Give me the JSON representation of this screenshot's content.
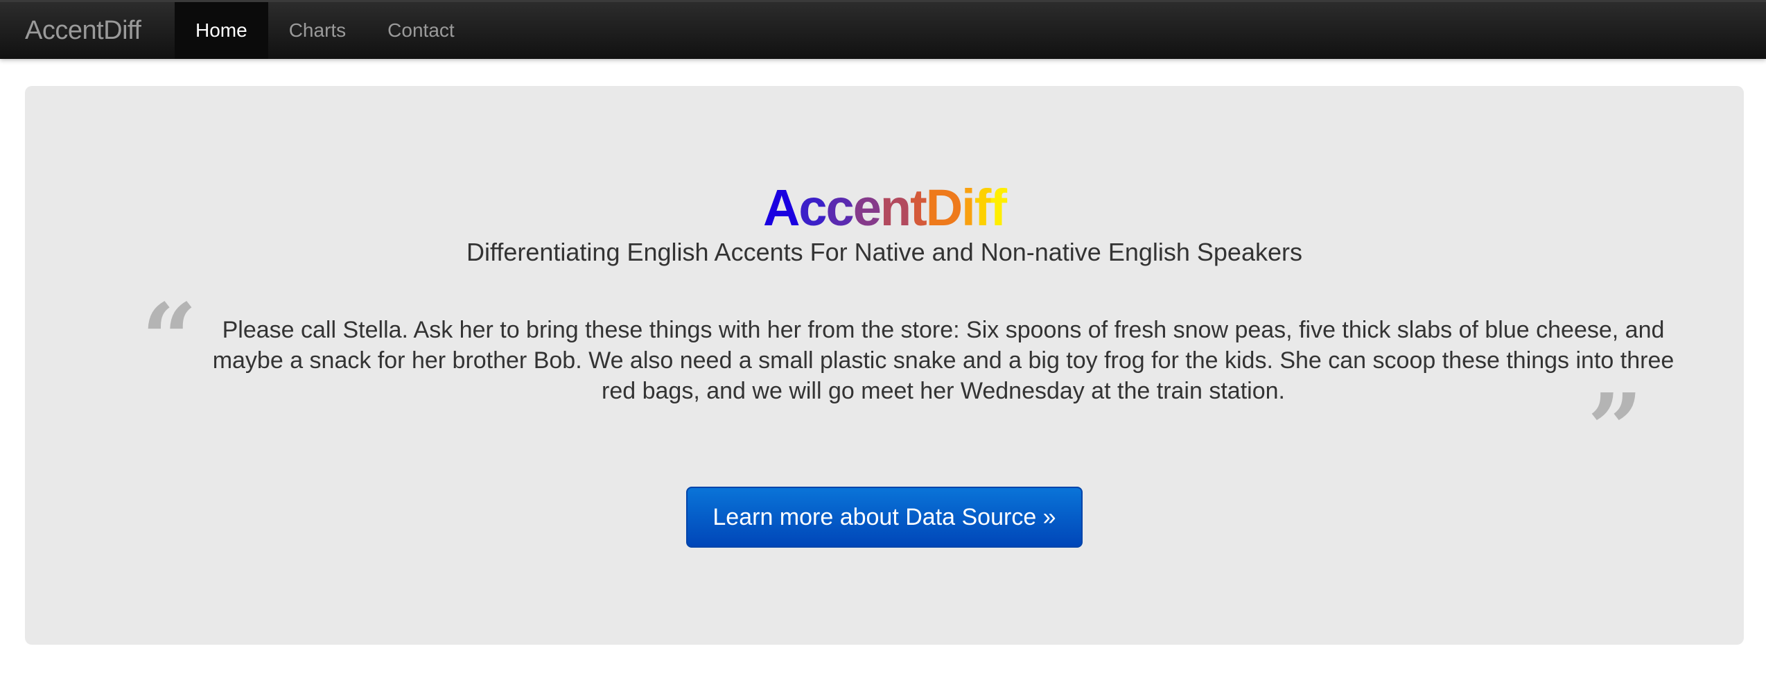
{
  "navbar": {
    "brand": "AccentDiff",
    "items": [
      {
        "label": "Home",
        "active": true
      },
      {
        "label": "Charts",
        "active": false
      },
      {
        "label": "Contact",
        "active": false
      }
    ]
  },
  "hero": {
    "logo_letters": [
      {
        "char": "A",
        "color": "#1a00e0"
      },
      {
        "char": "c",
        "color": "#3c20c8"
      },
      {
        "char": "c",
        "color": "#5a2ab0"
      },
      {
        "char": "e",
        "color": "#853a8a"
      },
      {
        "char": "n",
        "color": "#b24a5e"
      },
      {
        "char": "t",
        "color": "#d45a3a"
      },
      {
        "char": "D",
        "color": "#ee7a1c"
      },
      {
        "char": "i",
        "color": "#f9a010"
      },
      {
        "char": "f",
        "color": "#fdd000"
      },
      {
        "char": "f",
        "color": "#ffee00"
      }
    ],
    "subtitle": "Differentiating English Accents For Native and Non-native English Speakers",
    "quote_open": "“",
    "quote_close": "”",
    "quote": "Please call Stella. Ask her to bring these things with her from the store: Six spoons of fresh snow peas, five thick slabs of blue cheese, and maybe a snack for her brother Bob. We also need a small plastic snake and a big toy frog for the kids. She can scoop these things into three red bags, and we will go meet her Wednesday at the train station.",
    "cta_label": "Learn more about Data Source »"
  },
  "colors": {
    "navbar_bg": "#1a1a1a",
    "hero_bg": "#e9e9e9",
    "cta_bg": "#0059c8"
  }
}
